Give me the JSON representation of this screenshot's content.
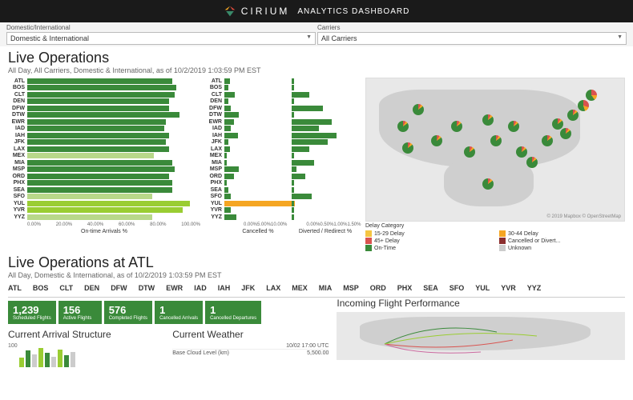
{
  "header": {
    "brand": "CIRIUM",
    "suffix": "ANALYTICS DASHBOARD"
  },
  "filters": {
    "domestic_label": "Domestic/International",
    "domestic_value": "Domestic & International",
    "carriers_label": "Carriers",
    "carriers_value": "All Carriers"
  },
  "live_ops": {
    "title": "Live Operations",
    "subtitle": "All Day, All Carriers, Domestic & International, as of 10/2/2019 1:03:59 PM EST"
  },
  "airports": [
    "ATL",
    "BOS",
    "CLT",
    "DEN",
    "DFW",
    "DTW",
    "EWR",
    "IAD",
    "IAH",
    "JFK",
    "LAX",
    "MEX",
    "MIA",
    "MSP",
    "ORD",
    "PHX",
    "SEA",
    "SFO",
    "YUL",
    "YVR",
    "YYZ"
  ],
  "chart_data": [
    {
      "type": "bar",
      "orientation": "horizontal",
      "title": "On-time Arrivals %",
      "categories": [
        "ATL",
        "BOS",
        "CLT",
        "DEN",
        "DFW",
        "DTW",
        "EWR",
        "IAD",
        "IAH",
        "JFK",
        "LAX",
        "MEX",
        "MIA",
        "MSP",
        "ORD",
        "PHX",
        "SEA",
        "SFO",
        "YUL",
        "YVR",
        "YYZ"
      ],
      "values": [
        84,
        86,
        85,
        82,
        82,
        88,
        80,
        79,
        82,
        80,
        82,
        73,
        84,
        85,
        82,
        84,
        84,
        72,
        94,
        90,
        72
      ],
      "highlight": {
        "MEX": "light",
        "SFO": "light",
        "YUL": "yellowgreen",
        "YVR": "yellowgreen",
        "YYZ": "light"
      },
      "xlim": [
        0,
        100
      ],
      "xticks": [
        "0.00%",
        "20.00%",
        "40.00%",
        "60.00%",
        "80.00%",
        "100.00%"
      ]
    },
    {
      "type": "bar",
      "orientation": "horizontal",
      "title": "Cancelled %",
      "categories": [
        "ATL",
        "BOS",
        "CLT",
        "DEN",
        "DFW",
        "DTW",
        "EWR",
        "IAD",
        "IAH",
        "JFK",
        "LAX",
        "MEX",
        "MIA",
        "MSP",
        "ORD",
        "PHX",
        "SEA",
        "SFO",
        "YUL",
        "YVR",
        "YYZ"
      ],
      "values": [
        0.8,
        0.6,
        1.6,
        0.6,
        1.0,
        2.2,
        1.4,
        1.0,
        2.0,
        0.6,
        0.8,
        0.3,
        0.4,
        2.2,
        1.4,
        0.4,
        0.6,
        1.0,
        10.5,
        1.0,
        1.8
      ],
      "highlight": {
        "YUL": "orange"
      },
      "xlim": [
        0,
        10
      ],
      "xticks": [
        "0.00%",
        "5.00%",
        "10.00%"
      ]
    },
    {
      "type": "bar",
      "orientation": "horizontal",
      "title": "Diverted / Redirect %",
      "categories": [
        "ATL",
        "BOS",
        "CLT",
        "DEN",
        "DFW",
        "DTW",
        "EWR",
        "IAD",
        "IAH",
        "JFK",
        "LAX",
        "MEX",
        "MIA",
        "MSP",
        "ORD",
        "PHX",
        "SEA",
        "SFO",
        "YUL",
        "YVR",
        "YYZ"
      ],
      "values": [
        0.05,
        0.05,
        0.4,
        0.05,
        0.7,
        0.05,
        0.9,
        0.6,
        1.0,
        0.8,
        0.4,
        0.05,
        0.5,
        0.1,
        0.3,
        0.05,
        0.05,
        0.45,
        0.05,
        0.05,
        0.05
      ],
      "xlim": [
        0,
        1.5
      ],
      "xticks": [
        "0.00%",
        "0.50%",
        "1.00%",
        "1.50%"
      ]
    }
  ],
  "map": {
    "attribution": "© 2019 Mapbox © OpenStreetMap",
    "legend_title": "Delay Category",
    "legend": [
      {
        "label": "15-29 Delay",
        "color": "#f5c542"
      },
      {
        "label": "30-44 Delay",
        "color": "#f5a623"
      },
      {
        "label": "45+ Delay",
        "color": "#d9534f"
      },
      {
        "label": "Cancelled or Divert...",
        "color": "#8b2e2e"
      },
      {
        "label": "On-Time",
        "color": "#3a8a3a"
      },
      {
        "label": "Unknown",
        "color": "#cccccc"
      }
    ]
  },
  "atl": {
    "title": "Live Operations at ATL",
    "subtitle": "All Day, Domestic & International, as of 10/2/2019 1:03:59 PM EST",
    "tabs": [
      "ATL",
      "BOS",
      "CLT",
      "DEN",
      "DFW",
      "DTW",
      "EWR",
      "IAD",
      "IAH",
      "JFK",
      "LAX",
      "MEX",
      "MIA",
      "MSP",
      "ORD",
      "PHX",
      "SEA",
      "SFO",
      "YUL",
      "YVR",
      "YYZ"
    ],
    "active_tab": "ATL",
    "stats": [
      {
        "value": "1,239",
        "label": "Scheduled Flights"
      },
      {
        "value": "156",
        "label": "Active Flights"
      },
      {
        "value": "576",
        "label": "Completed Flights"
      },
      {
        "value": "1",
        "label": "Cancelled Arrivals"
      },
      {
        "value": "1",
        "label": "Cancelled Departures"
      }
    ]
  },
  "lower": {
    "arrival_title": "Current Arrival Structure",
    "arrival_ytick": "100",
    "weather_title": "Current Weather",
    "weather_time": "10/02 17:00 UTC",
    "weather_rows": [
      {
        "k": "Base Cloud Level (km)",
        "v": "5,500.00"
      }
    ],
    "incoming_title": "Incoming Flight Performance"
  }
}
